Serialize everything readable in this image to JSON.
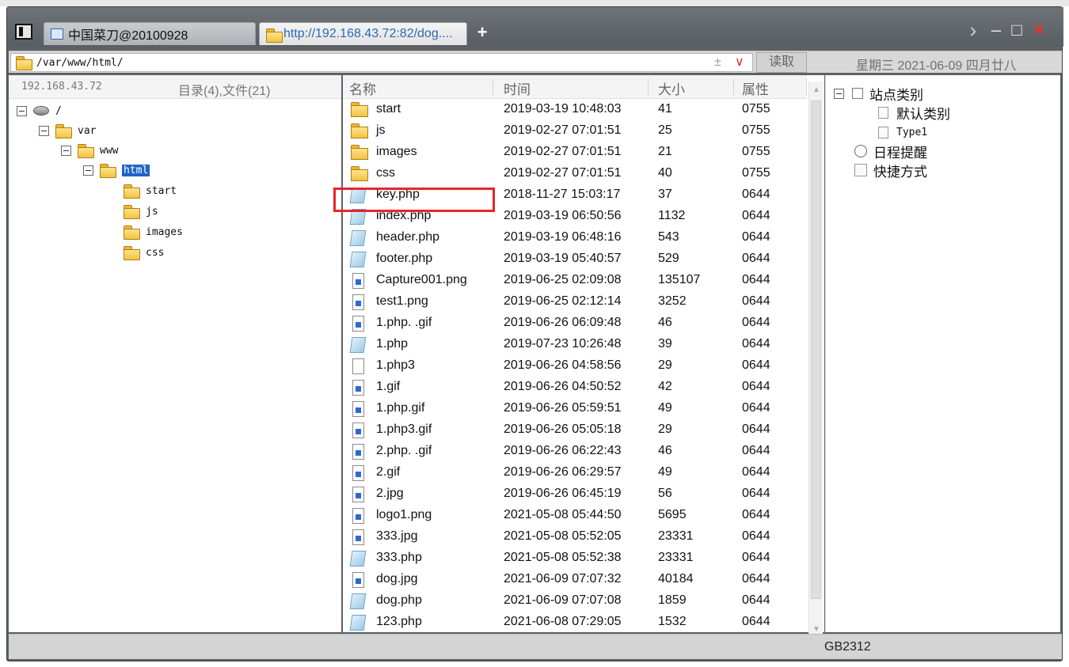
{
  "tabs": [
    {
      "label": "中国菜刀@20100928"
    },
    {
      "label": "http://192.168.43.72:82/dog...."
    }
  ],
  "address": {
    "path": "/var/www/html/",
    "read_button": "读取",
    "date": "星期三 2021-06-09 四月廿八"
  },
  "left_pane": {
    "host": "192.168.43.72",
    "summary": "目录(4),文件(21)",
    "tree": [
      {
        "label": "/"
      },
      {
        "label": "var"
      },
      {
        "label": "www"
      },
      {
        "label": "html"
      },
      {
        "label": "start"
      },
      {
        "label": "js"
      },
      {
        "label": "images"
      },
      {
        "label": "css"
      }
    ]
  },
  "file_list": {
    "columns": [
      "名称",
      "时间",
      "大小",
      "属性"
    ],
    "rows": [
      {
        "name": "start",
        "time": "2019-03-19 10:48:03",
        "size": "41",
        "attr": "0755",
        "icon": "folder-icon"
      },
      {
        "name": "js",
        "time": "2019-02-27 07:01:51",
        "size": "25",
        "attr": "0755",
        "icon": "folder-icon"
      },
      {
        "name": "images",
        "time": "2019-02-27 07:01:51",
        "size": "21",
        "attr": "0755",
        "icon": "folder-icon"
      },
      {
        "name": "css",
        "time": "2019-02-27 07:01:51",
        "size": "40",
        "attr": "0755",
        "icon": "folder-icon"
      },
      {
        "name": "key.php",
        "time": "2018-11-27 15:03:17",
        "size": "37",
        "attr": "0644",
        "icon": "php-file-icon"
      },
      {
        "name": "index.php",
        "time": "2019-03-19 06:50:56",
        "size": "1132",
        "attr": "0644",
        "icon": "php-file-icon"
      },
      {
        "name": "header.php",
        "time": "2019-03-19 06:48:16",
        "size": "543",
        "attr": "0644",
        "icon": "php-file-icon"
      },
      {
        "name": "footer.php",
        "time": "2019-03-19 05:40:57",
        "size": "529",
        "attr": "0644",
        "icon": "php-file-icon"
      },
      {
        "name": "Capture001.png",
        "time": "2019-06-25 02:09:08",
        "size": "135107",
        "attr": "0644",
        "icon": "image-file-icon"
      },
      {
        "name": "test1.png",
        "time": "2019-06-25 02:12:14",
        "size": "3252",
        "attr": "0644",
        "icon": "image-file-icon"
      },
      {
        "name": "1.php.  .gif",
        "time": "2019-06-26 06:09:48",
        "size": "46",
        "attr": "0644",
        "icon": "image-file-icon"
      },
      {
        "name": "1.php",
        "time": "2019-07-23 10:26:48",
        "size": "39",
        "attr": "0644",
        "icon": "php-file-icon"
      },
      {
        "name": "1.php3",
        "time": "2019-06-26 04:58:56",
        "size": "29",
        "attr": "0644",
        "icon": "blank-file-icon"
      },
      {
        "name": "1.gif",
        "time": "2019-06-26 04:50:52",
        "size": "42",
        "attr": "0644",
        "icon": "image-file-icon"
      },
      {
        "name": "1.php.gif",
        "time": "2019-06-26 05:59:51",
        "size": "49",
        "attr": "0644",
        "icon": "image-file-icon"
      },
      {
        "name": "1.php3.gif",
        "time": "2019-06-26 05:05:18",
        "size": "29",
        "attr": "0644",
        "icon": "image-file-icon"
      },
      {
        "name": "2.php.  .gif",
        "time": "2019-06-26 06:22:43",
        "size": "46",
        "attr": "0644",
        "icon": "image-file-icon"
      },
      {
        "name": "2.gif",
        "time": "2019-06-26 06:29:57",
        "size": "49",
        "attr": "0644",
        "icon": "image-file-icon"
      },
      {
        "name": "2.jpg",
        "time": "2019-06-26 06:45:19",
        "size": "56",
        "attr": "0644",
        "icon": "image-file-icon"
      },
      {
        "name": "logo1.png",
        "time": "2021-05-08 05:44:50",
        "size": "5695",
        "attr": "0644",
        "icon": "image-file-icon"
      },
      {
        "name": "333.jpg",
        "time": "2021-05-08 05:52:05",
        "size": "23331",
        "attr": "0644",
        "icon": "image-file-icon"
      },
      {
        "name": "333.php",
        "time": "2021-05-08 05:52:38",
        "size": "23331",
        "attr": "0644",
        "icon": "php-file-icon"
      },
      {
        "name": "dog.jpg",
        "time": "2021-06-09 07:07:32",
        "size": "40184",
        "attr": "0644",
        "icon": "image-file-icon"
      },
      {
        "name": "dog.php",
        "time": "2021-06-09 07:07:08",
        "size": "1859",
        "attr": "0644",
        "icon": "php-file-icon"
      },
      {
        "name": "123.php",
        "time": "2021-06-08 07:29:05",
        "size": "1532",
        "attr": "0644",
        "icon": "php-file-icon"
      }
    ]
  },
  "right_pane": {
    "items": [
      {
        "label": "站点类别"
      },
      {
        "label": "默认类别"
      },
      {
        "label": "Type1"
      },
      {
        "label": "日程提醒"
      },
      {
        "label": "快捷方式"
      }
    ]
  },
  "status": {
    "encoding": "GB2312"
  },
  "colors": {
    "highlight": "#e8262a",
    "selection": "#1e64c8",
    "title_bar": "#5c6166"
  }
}
